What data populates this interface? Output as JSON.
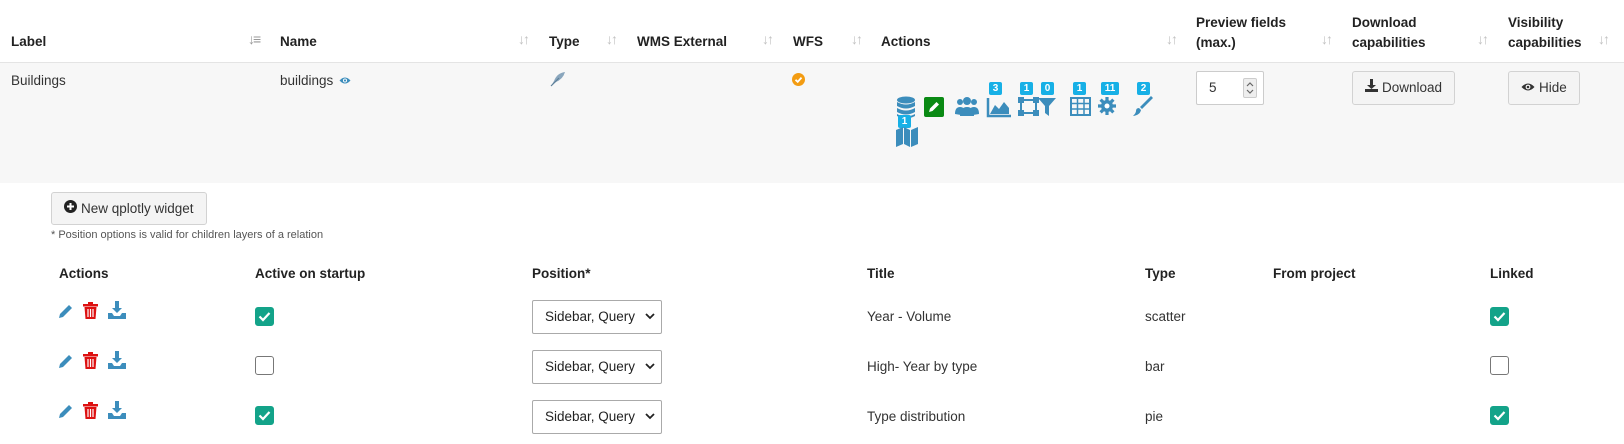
{
  "layers_table": {
    "headers": {
      "label": "Label",
      "name": "Name",
      "type": "Type",
      "wms_external": "WMS External",
      "wfs": "WFS",
      "actions": "Actions",
      "preview_fields_1": "Preview fields",
      "preview_fields_2": "(max.)",
      "download_cap_1": "Download",
      "download_cap_2": "capabilities",
      "visibility_cap_1": "Visibility",
      "visibility_cap_2": "capabilities"
    },
    "row": {
      "label": "Buildings",
      "name": "buildings",
      "preview_fields_value": "5",
      "download_label": "Download",
      "hide_label": "Hide",
      "badges": {
        "datasource": "1",
        "plots": "3",
        "editing": "1",
        "filter": "0",
        "table": "1",
        "settings": "11",
        "style": "2"
      }
    }
  },
  "new_widget_label": "New qplotly widget",
  "position_note": "* Position options is valid for children layers of a relation",
  "widgets_table": {
    "headers": {
      "actions": "Actions",
      "active": "Active on startup",
      "position": "Position*",
      "title": "Title",
      "type": "Type",
      "from_project": "From project",
      "linked": "Linked"
    },
    "rows": [
      {
        "active": true,
        "position": "Sidebar, Query",
        "title": "Year - Volume",
        "type": "scatter",
        "from_project": "",
        "linked": true
      },
      {
        "active": false,
        "position": "Sidebar, Query",
        "title": "High- Year by type",
        "type": "bar",
        "from_project": "",
        "linked": false
      },
      {
        "active": true,
        "position": "Sidebar, Query",
        "title": "Type distribution",
        "type": "pie",
        "from_project": "",
        "linked": true
      }
    ]
  },
  "colors": {
    "accent_blue": "#3c8dbc",
    "badge_cyan": "#17b0e6",
    "check_green": "#13a389",
    "delete_red": "#dd1111",
    "edit_green": "#0a8a14",
    "wfs_orange": "#f39c12"
  }
}
